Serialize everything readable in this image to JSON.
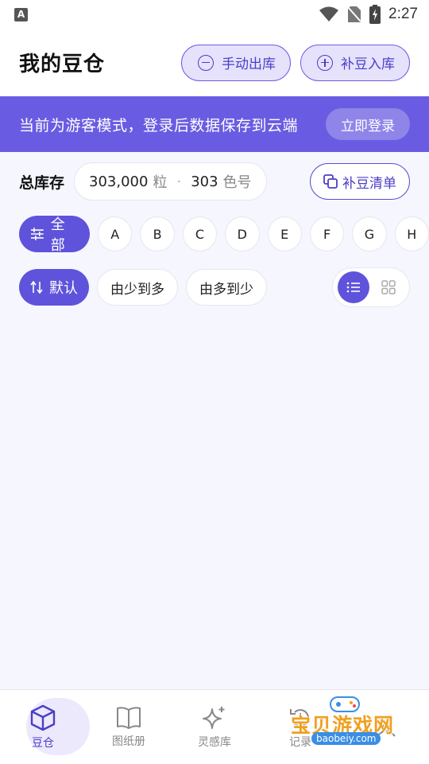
{
  "status_bar": {
    "app_badge": "A",
    "time": "2:27"
  },
  "header": {
    "title": "我的豆仓",
    "stock_out_label": "手动出库",
    "stock_in_label": "补豆入库"
  },
  "banner": {
    "message": "当前为游客模式，登录后数据保存到云端",
    "login_label": "立即登录"
  },
  "inventory": {
    "label": "总库存",
    "count": "303,000",
    "count_unit": "粒",
    "separator": "·",
    "colors": "303",
    "colors_unit": "色号",
    "restock_list_label": "补豆清单"
  },
  "filters": {
    "all_label": "全部",
    "letters": [
      "A",
      "B",
      "C",
      "D",
      "E",
      "F",
      "G",
      "H"
    ]
  },
  "sort": {
    "default_label": "默认",
    "asc_label": "由少到多",
    "desc_label": "由多到少",
    "view_mode": "list"
  },
  "bottom_nav": {
    "items": [
      {
        "label": "豆仓",
        "icon": "cube-icon",
        "active": true
      },
      {
        "label": "图纸册",
        "icon": "book-icon",
        "active": false
      },
      {
        "label": "灵感库",
        "icon": "sparkle-icon",
        "active": false
      },
      {
        "label": "记录",
        "icon": "history-icon",
        "active": false
      },
      {
        "label": "",
        "icon": "profile-icon",
        "active": false
      }
    ]
  },
  "watermark": {
    "text": "宝贝游戏网",
    "url": "baobeiy.com"
  },
  "colors": {
    "accent": "#5f53db",
    "banner": "#6a5ce2",
    "background": "#f6f7fe"
  }
}
